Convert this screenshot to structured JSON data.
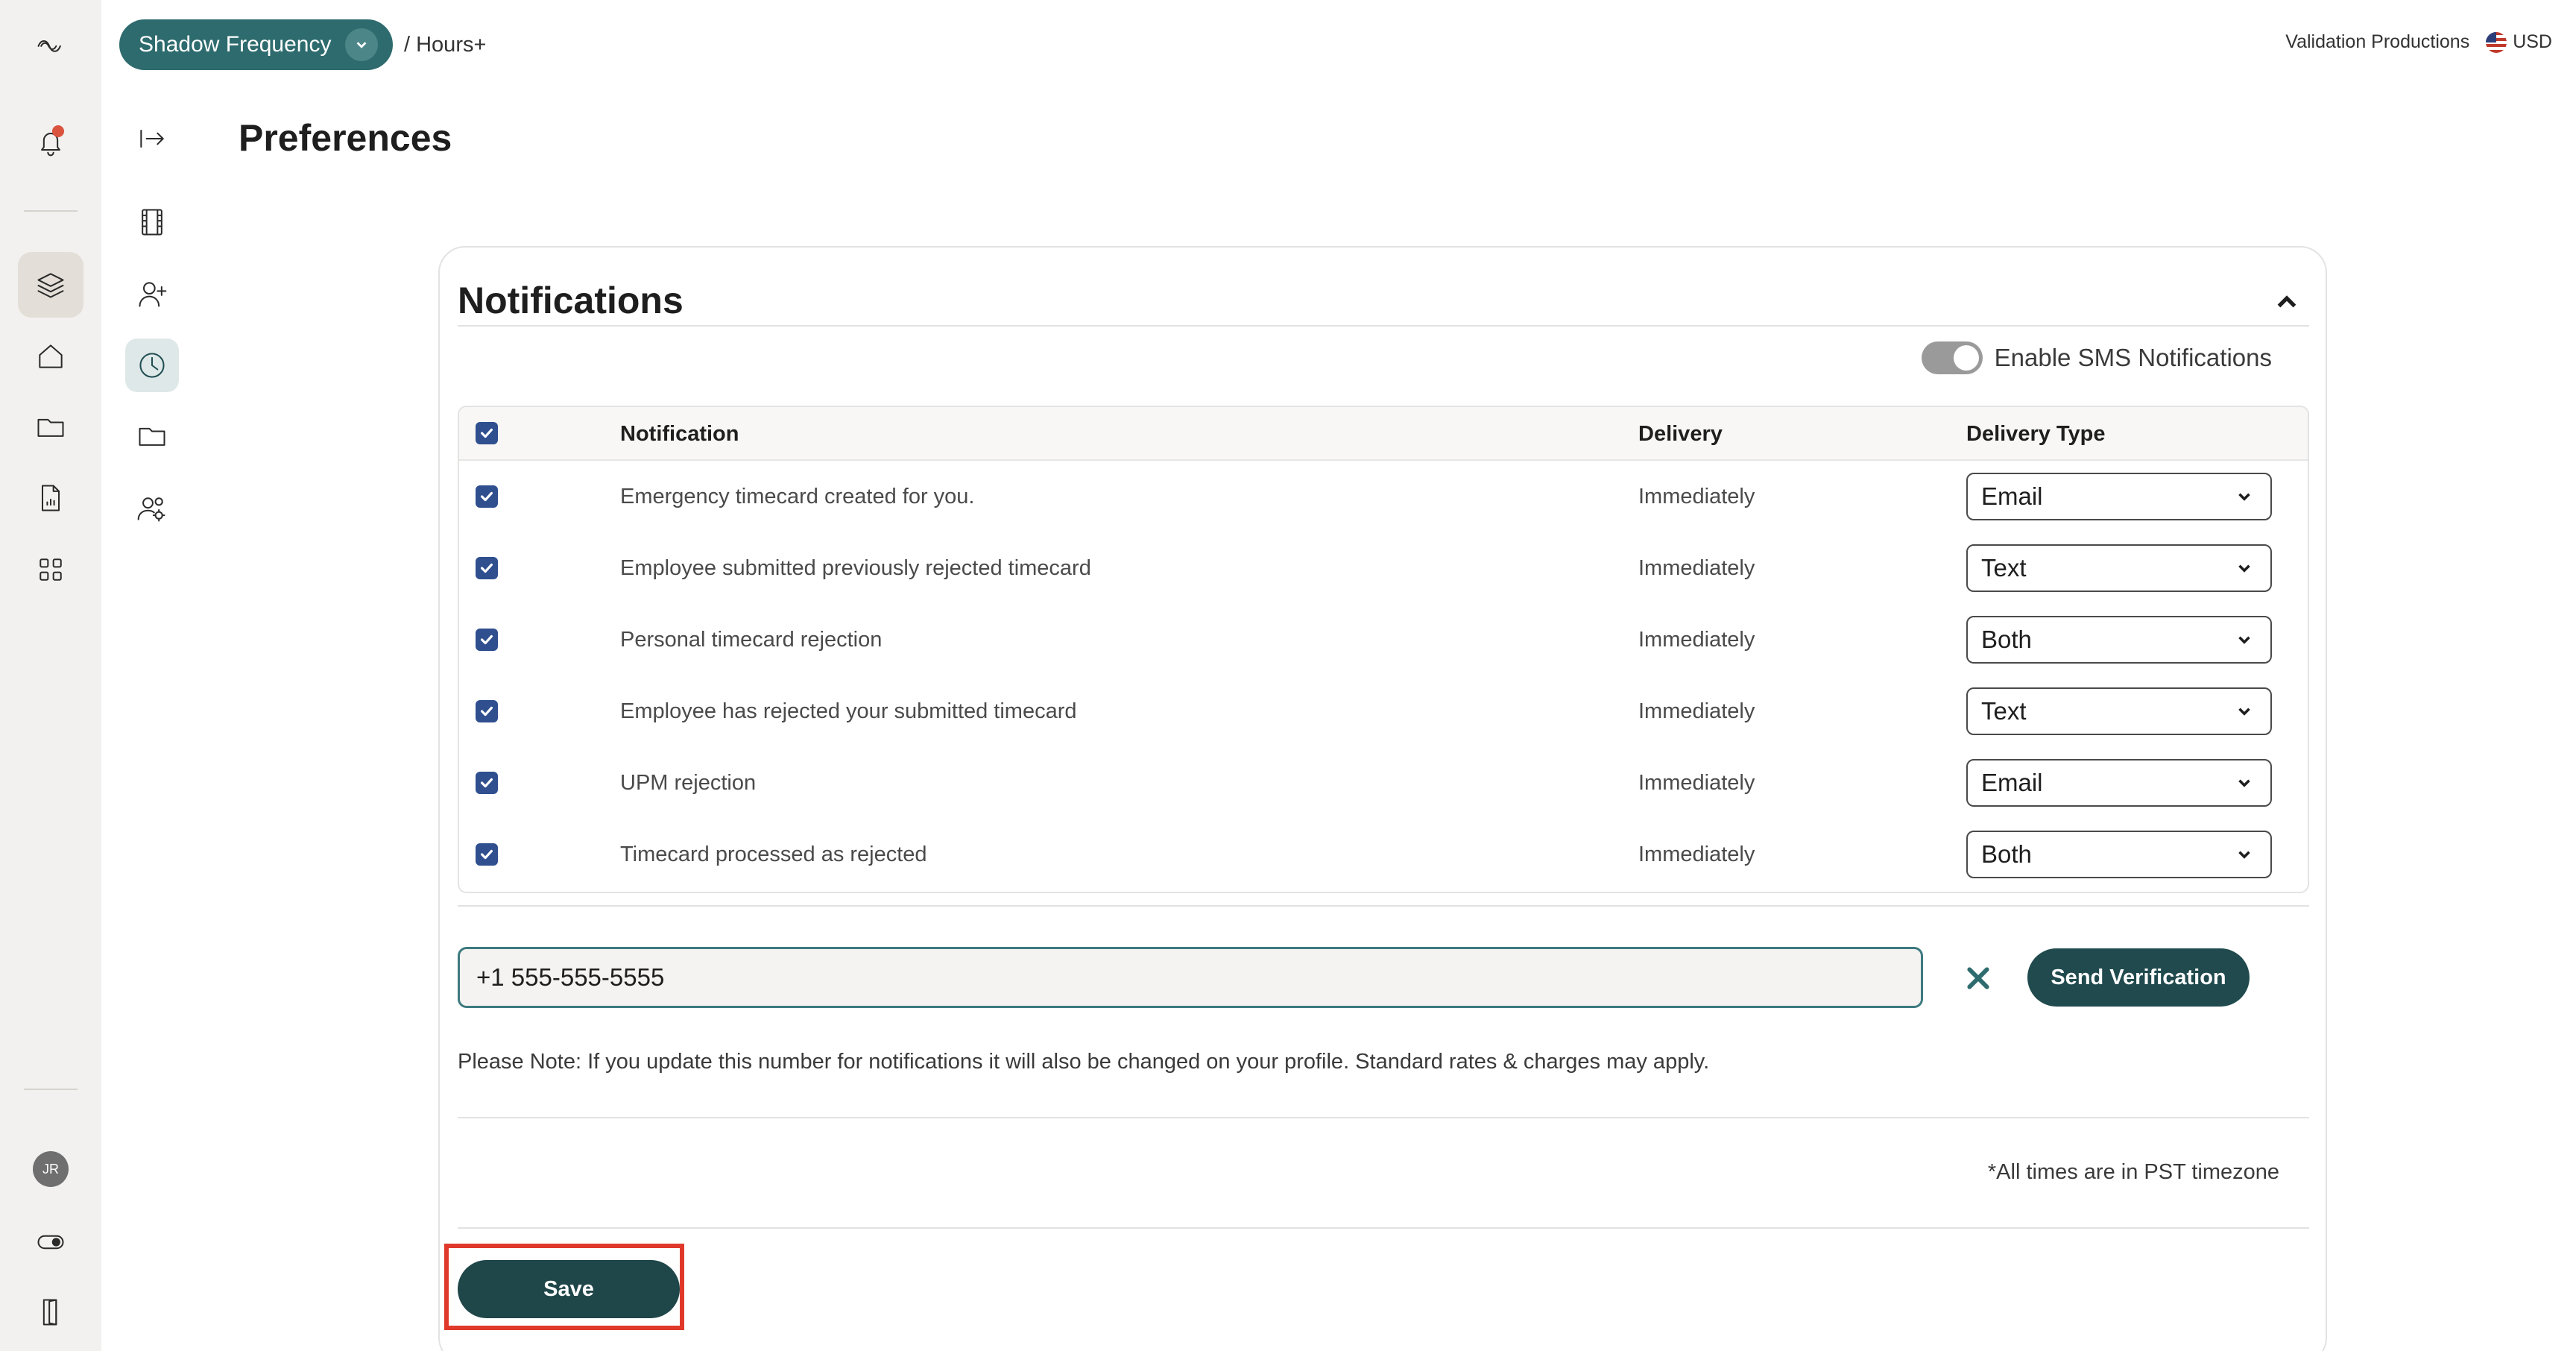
{
  "rail": {
    "items": [
      {
        "name": "logo-icon"
      },
      {
        "name": "bell-icon",
        "badge": true
      },
      {
        "name": "layers-icon",
        "active": true
      },
      {
        "name": "home-icon"
      },
      {
        "name": "folder-icon"
      },
      {
        "name": "document-icon"
      },
      {
        "name": "apps-grid-icon"
      }
    ],
    "avatar_initials": "JR",
    "bottom_items": [
      {
        "name": "toggle-icon"
      },
      {
        "name": "exit-door-icon"
      }
    ]
  },
  "subnav": {
    "items": [
      {
        "name": "collapse-arrow-icon"
      },
      {
        "name": "film-icon"
      },
      {
        "name": "add-user-icon"
      },
      {
        "name": "clock-icon",
        "active": true
      },
      {
        "name": "folder-icon"
      },
      {
        "name": "team-settings-icon"
      }
    ]
  },
  "header": {
    "project_name": "Shadow Frequency",
    "breadcrumb": "/ Hours+",
    "company": "Validation Productions",
    "currency": "USD"
  },
  "page": {
    "title": "Preferences"
  },
  "notifications": {
    "section_title": "Notifications",
    "sms_toggle_label": "Enable SMS Notifications",
    "sms_enabled": true,
    "columns": {
      "notification": "Notification",
      "delivery": "Delivery",
      "delivery_type": "Delivery Type"
    },
    "rows": [
      {
        "label": "Emergency timecard created for you.",
        "delivery": "Immediately",
        "type": "Email",
        "checked": true
      },
      {
        "label": "Employee submitted previously rejected timecard",
        "delivery": "Immediately",
        "type": "Text",
        "checked": true
      },
      {
        "label": "Personal timecard rejection",
        "delivery": "Immediately",
        "type": "Both",
        "checked": true
      },
      {
        "label": "Employee has rejected your submitted timecard",
        "delivery": "Immediately",
        "type": "Text",
        "checked": true
      },
      {
        "label": "UPM rejection",
        "delivery": "Immediately",
        "type": "Email",
        "checked": true
      },
      {
        "label": "Timecard processed as rejected",
        "delivery": "Immediately",
        "type": "Both",
        "checked": true
      }
    ],
    "phone_value": "+1 555-555-5555",
    "send_verification_label": "Send Verification",
    "note": "Please Note: If you update this number for notifications it will also be changed on your profile. Standard rates & charges may apply.",
    "timezone_note": "*All times are in PST timezone",
    "save_label": "Save"
  },
  "colors": {
    "accent": "#2e6b6e",
    "button_dark": "#1f4649",
    "checkbox": "#2f4f8f",
    "highlight": "#e0392b"
  }
}
